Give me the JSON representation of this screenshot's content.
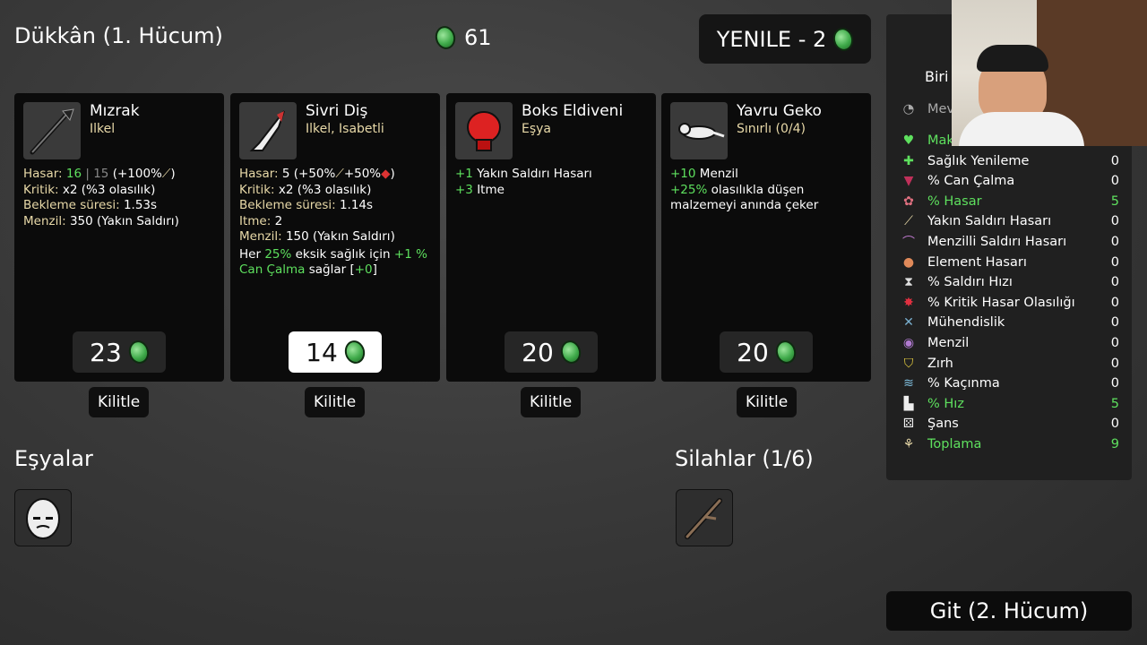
{
  "header": {
    "title": "Dükkân (1. Hücum)",
    "materials": "61",
    "reroll_label": "YENILE - 2"
  },
  "shop": [
    {
      "name": "Mızrak",
      "sub": "Ilkel",
      "price": "23",
      "lock": "Kilitle",
      "stats": {
        "hasar_label": "Hasar:",
        "hasar_val": "16",
        "hasar_sep": " | ",
        "hasar_base": "15",
        "hasar_extra": " (+100%",
        "kritik": "Kritik:",
        "kritik_val": " x2 (%3 olasılık)",
        "bekleme": "Bekleme süresi:",
        "bekleme_val": " 1.53s",
        "menzil": "Menzil:",
        "menzil_val": " 350 (Yakın Saldırı)"
      }
    },
    {
      "name": "Sivri Diş",
      "sub": "Ilkel, Isabetli",
      "price": "14",
      "lock": "Kilitle",
      "stats": {
        "hasar_label": "Hasar:",
        "hasar_val": " 5 (+50%",
        "hasar_mid": "+50%",
        "hasar_end": ")",
        "kritik": "Kritik:",
        "kritik_val": " x2 (%3 olasılık)",
        "bekleme": "Bekleme süresi:",
        "bekleme_val": " 1.14s",
        "itme": "Itme:",
        "itme_val": " 2",
        "menzil": "Menzil:",
        "menzil_val": " 150 (Yakın Saldırı)",
        "her": "Her ",
        "pct": "25%",
        "eksik": " eksik sağlık için ",
        "plus": "+1 %",
        "can": "Can Çalma",
        "saglar": " sağlar [",
        "bonus": "+0",
        "close": "]"
      }
    },
    {
      "name": "Boks Eldiveni",
      "sub": "Eşya",
      "price": "20",
      "lock": "Kilitle",
      "stats": {
        "l1g": "+1",
        "l1": " Yakın Saldırı Hasarı",
        "l2g": "+3",
        "l2": " Itme"
      }
    },
    {
      "name": "Yavru Geko",
      "sub": "Sınırlı (0/4)",
      "price": "20",
      "lock": "Kilitle",
      "stats": {
        "l1g": "+10",
        "l1": " Menzil",
        "l2g": "+25%",
        "l2": " olasılıkla düşen",
        "l3": "malzemeyi anında çeker"
      }
    }
  ],
  "items_title": "Eşyalar",
  "weapons_title": "Silahlar (1/6)",
  "stats_panel": {
    "tab_partial": "Biri",
    "level_partial": "Mev",
    "rows": [
      {
        "label": "Maks",
        "value": "",
        "color": "#5ee05e",
        "icon": "heart-icon"
      },
      {
        "label": "Sağlık Yenileme",
        "value": "0",
        "color": "#ffffff",
        "icon": "heart-plus-icon"
      },
      {
        "label": "% Can Çalma",
        "value": "0",
        "color": "#ffffff",
        "icon": "fangs-icon"
      },
      {
        "label": "% Hasar",
        "value": "5",
        "color": "#5ee05e",
        "icon": "brain-icon"
      },
      {
        "label": "Yakın Saldırı Hasarı",
        "value": "0",
        "color": "#ffffff",
        "icon": "sword-icon"
      },
      {
        "label": "Menzilli Saldırı Hasarı",
        "value": "0",
        "color": "#ffffff",
        "icon": "bow-icon"
      },
      {
        "label": "Element Hasarı",
        "value": "0",
        "color": "#ffffff",
        "icon": "flame-icon"
      },
      {
        "label": "% Saldırı Hızı",
        "value": "0",
        "color": "#ffffff",
        "icon": "hourglass-icon"
      },
      {
        "label": "% Kritik Hasar Olasılığı",
        "value": "0",
        "color": "#ffffff",
        "icon": "crit-icon"
      },
      {
        "label": "Mühendislik",
        "value": "0",
        "color": "#ffffff",
        "icon": "wrench-icon"
      },
      {
        "label": "Menzil",
        "value": "0",
        "color": "#ffffff",
        "icon": "range-icon"
      },
      {
        "label": "Zırh",
        "value": "0",
        "color": "#ffffff",
        "icon": "shield-icon"
      },
      {
        "label": "% Kaçınma",
        "value": "0",
        "color": "#ffffff",
        "icon": "dodge-icon"
      },
      {
        "label": "% Hız",
        "value": "5",
        "color": "#5ee05e",
        "icon": "boot-icon"
      },
      {
        "label": "Şans",
        "value": "0",
        "color": "#ffffff",
        "icon": "dice-icon"
      },
      {
        "label": "Toplama",
        "value": "9",
        "color": "#5ee05e",
        "icon": "wheat-icon"
      }
    ]
  },
  "go_label": "Git (2. Hücum)"
}
